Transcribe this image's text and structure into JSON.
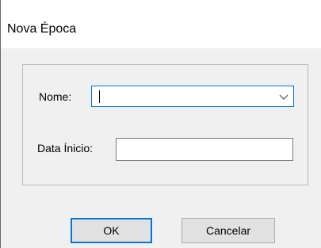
{
  "window": {
    "title": "Nova Época"
  },
  "form": {
    "nome_label": "Nome:",
    "nome_value": "",
    "data_inicio_label": "Data Ínicio:",
    "data_inicio_value": ""
  },
  "buttons": {
    "ok_label": "OK",
    "cancel_label": "Cancelar"
  },
  "icons": {
    "dropdown": "chevron-down-icon"
  },
  "colors": {
    "focus_border": "#0078d7",
    "button_face": "#e1e1e1",
    "dialog_background": "#f0f0f0"
  }
}
